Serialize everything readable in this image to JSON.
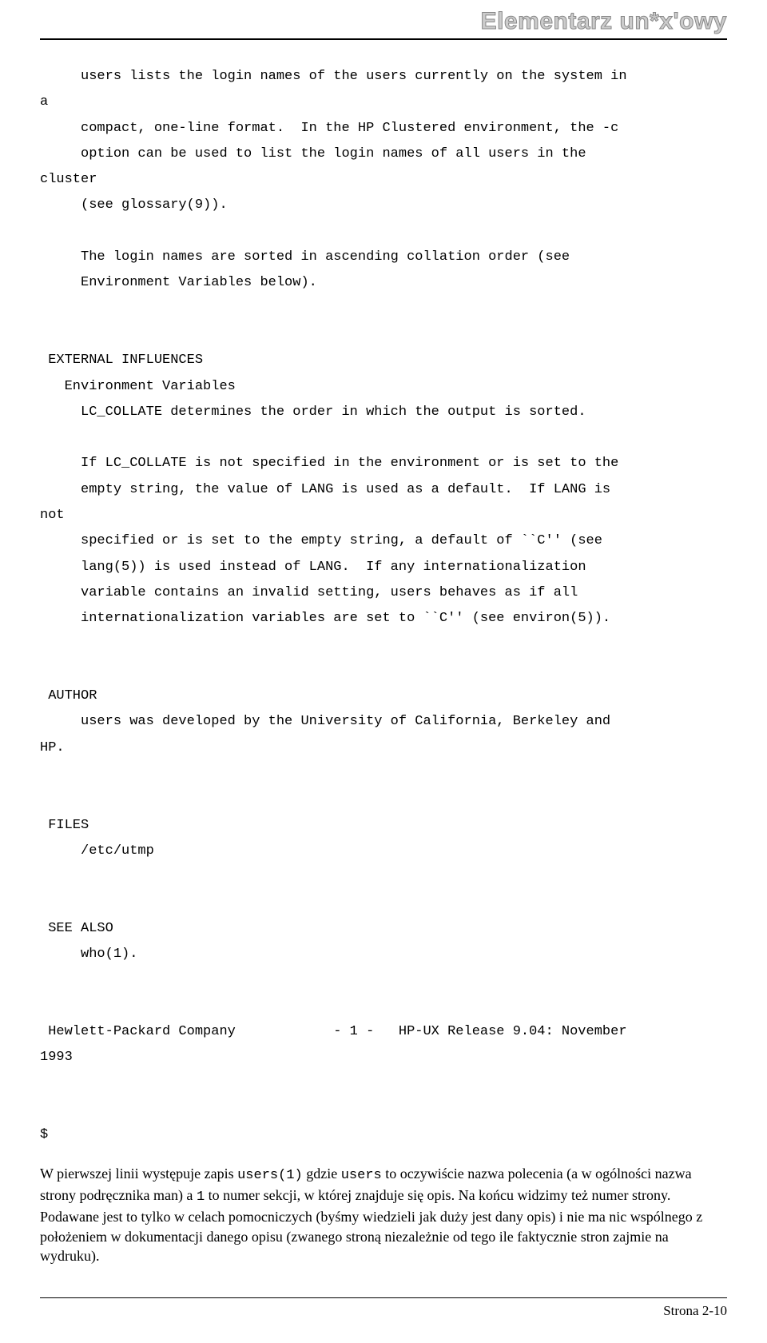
{
  "header": {
    "title": "Elementarz un*x'owy"
  },
  "man": {
    "p1_l1": "     users lists the login names of the users currently on the system in",
    "p1_l2": "a",
    "p1_l3": "     compact, one-line format.  In the HP Clustered environment, the -c",
    "p1_l4": "     option can be used to list the login names of all users in the",
    "p1_l5": "cluster",
    "p1_l6": "     (see glossary(9)).",
    "p2_l1": "     The login names are sorted in ascending collation order (see",
    "p2_l2": "     Environment Variables below).",
    "ext_infl": " EXTERNAL INFLUENCES",
    "env_vars": "   Environment Variables",
    "lc_l1": "     LC_COLLATE determines the order in which the output is sorted.",
    "lc2_l1": "     If LC_COLLATE is not specified in the environment or is set to the",
    "lc2_l2": "     empty string, the value of LANG is used as a default.  If LANG is",
    "lc2_l3": "not",
    "lc2_l4": "     specified or is set to the empty string, a default of ``C'' (see",
    "lc2_l5": "     lang(5)) is used instead of LANG.  If any internationalization",
    "lc2_l6": "     variable contains an invalid setting, users behaves as if all",
    "lc2_l7": "     internationalization variables are set to ``C'' (see environ(5)).",
    "author": " AUTHOR",
    "author_l1": "     users was developed by the University of California, Berkeley and",
    "author_l2": "HP.",
    "files": " FILES",
    "files_l1": "     /etc/utmp",
    "see_also": " SEE ALSO",
    "see_also_l1": "     who(1).",
    "colophon": " Hewlett-Packard Company            - 1 -   HP-UX Release 9.04: November",
    "colophon_y": "1993",
    "prompt": "$"
  },
  "body": {
    "sentence_start": "W pierwszej linii występuje zapis ",
    "inline1": "users(1)",
    "mid1": " gdzie ",
    "inline2": "users",
    "mid2": " to oczywiście nazwa polecenia (a w ogólności nazwa strony podręcznika man) a ",
    "inline3": "1",
    "mid3": " to numer sekcji, w której znajduje się opis. Na końcu widzimy też numer strony. Podawane jest to tylko w celach pomocniczych (byśmy wiedzieli jak duży jest dany opis) i nie ma nic wspólnego z położeniem w dokumentacji danego opisu (zwanego stroną niezależnie od tego ile faktycznie stron zajmie na wydruku)."
  },
  "footer": {
    "page": "Strona 2-10"
  }
}
